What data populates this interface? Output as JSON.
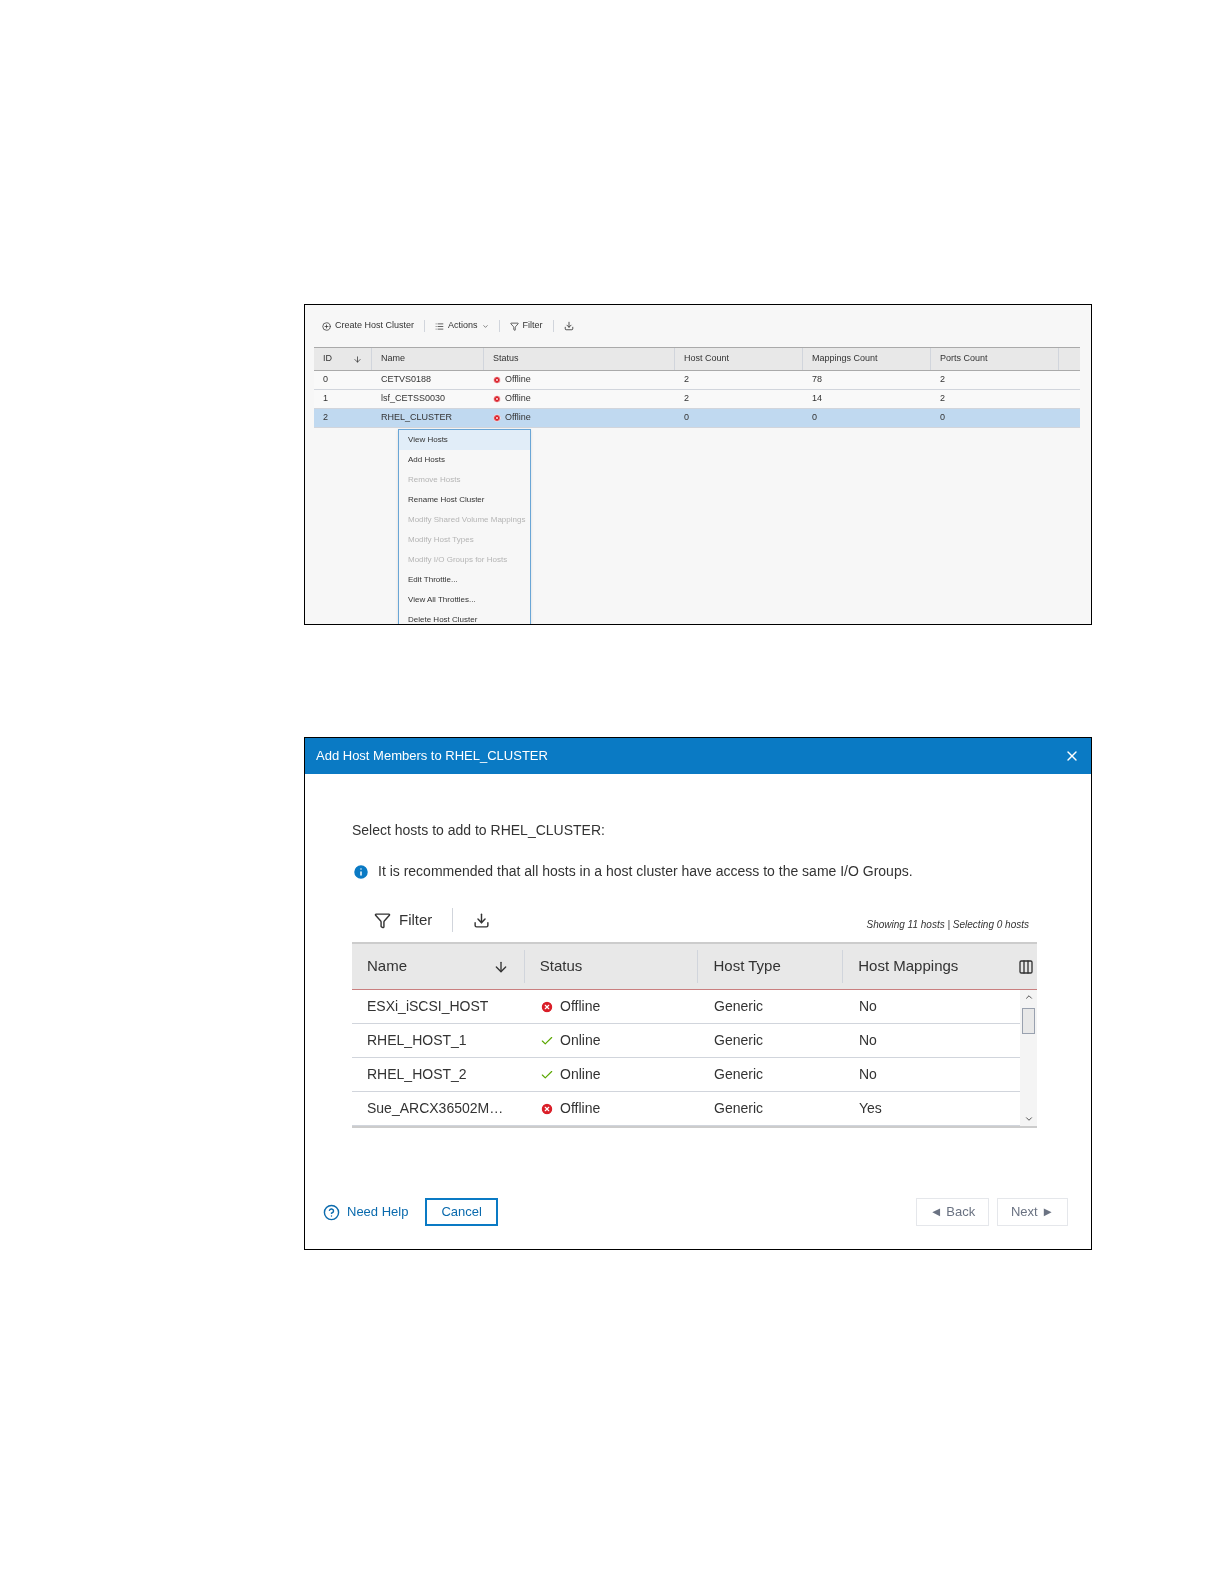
{
  "cluster_panel": {
    "toolbar": {
      "create": "Create Host Cluster",
      "actions": "Actions",
      "filter": "Filter"
    },
    "table": {
      "columns": [
        "ID",
        "Name",
        "Status",
        "Host Count",
        "Mappings Count",
        "Ports Count"
      ],
      "rows": [
        {
          "id": "0",
          "name": "CETVS0188",
          "status": "Offline",
          "kind": "offline",
          "host_count": "2",
          "mappings_count": "78",
          "ports_count": "2",
          "selected": false
        },
        {
          "id": "1",
          "name": "lsf_CETSS0030",
          "status": "Offline",
          "kind": "offline",
          "host_count": "2",
          "mappings_count": "14",
          "ports_count": "2",
          "selected": false
        },
        {
          "id": "2",
          "name": "RHEL_CLUSTER",
          "status": "Offline",
          "kind": "offline",
          "host_count": "0",
          "mappings_count": "0",
          "ports_count": "0",
          "selected": true
        }
      ]
    },
    "context_menu": [
      {
        "label": "View Hosts",
        "disabled": false,
        "selected": true
      },
      {
        "label": "Add Hosts",
        "disabled": false,
        "selected": false
      },
      {
        "label": "Remove Hosts",
        "disabled": true,
        "selected": false
      },
      {
        "label": "Rename Host Cluster",
        "disabled": false,
        "selected": false
      },
      {
        "label": "Modify Shared Volume Mappings",
        "disabled": true,
        "selected": false
      },
      {
        "label": "Modify Host Types",
        "disabled": true,
        "selected": false
      },
      {
        "label": "Modify I/O Groups for Hosts",
        "disabled": true,
        "selected": false
      },
      {
        "label": "Edit Throttle...",
        "disabled": false,
        "selected": false
      },
      {
        "label": "View All Throttles...",
        "disabled": false,
        "selected": false
      },
      {
        "label": "Delete Host Cluster",
        "disabled": false,
        "selected": false
      }
    ]
  },
  "dialog": {
    "title": "Add Host Members to RHEL_CLUSTER",
    "prompt": "Select hosts to add to RHEL_CLUSTER:",
    "info": "It is recommended that all hosts in a host cluster have access to the same I/O Groups.",
    "filter": "Filter",
    "summary": "Showing 11 hosts | Selecting 0 hosts",
    "table": {
      "columns": [
        "Name",
        "Status",
        "Host Type",
        "Host Mappings"
      ],
      "rows": [
        {
          "name": "ESXi_iSCSI_HOST",
          "status": "Offline",
          "kind": "offline",
          "host_type": "Generic",
          "host_mappings": "No"
        },
        {
          "name": "RHEL_HOST_1",
          "status": "Online",
          "kind": "online",
          "host_type": "Generic",
          "host_mappings": "No"
        },
        {
          "name": "RHEL_HOST_2",
          "status": "Online",
          "kind": "online",
          "host_type": "Generic",
          "host_mappings": "No"
        },
        {
          "name": "Sue_ARCX36502M…",
          "status": "Offline",
          "kind": "offline",
          "host_type": "Generic",
          "host_mappings": "Yes"
        }
      ]
    },
    "footer": {
      "help": "Need Help",
      "cancel": "Cancel",
      "back": "◄ Back",
      "back_disabled": true,
      "next": "Next ►",
      "next_disabled": true
    }
  }
}
